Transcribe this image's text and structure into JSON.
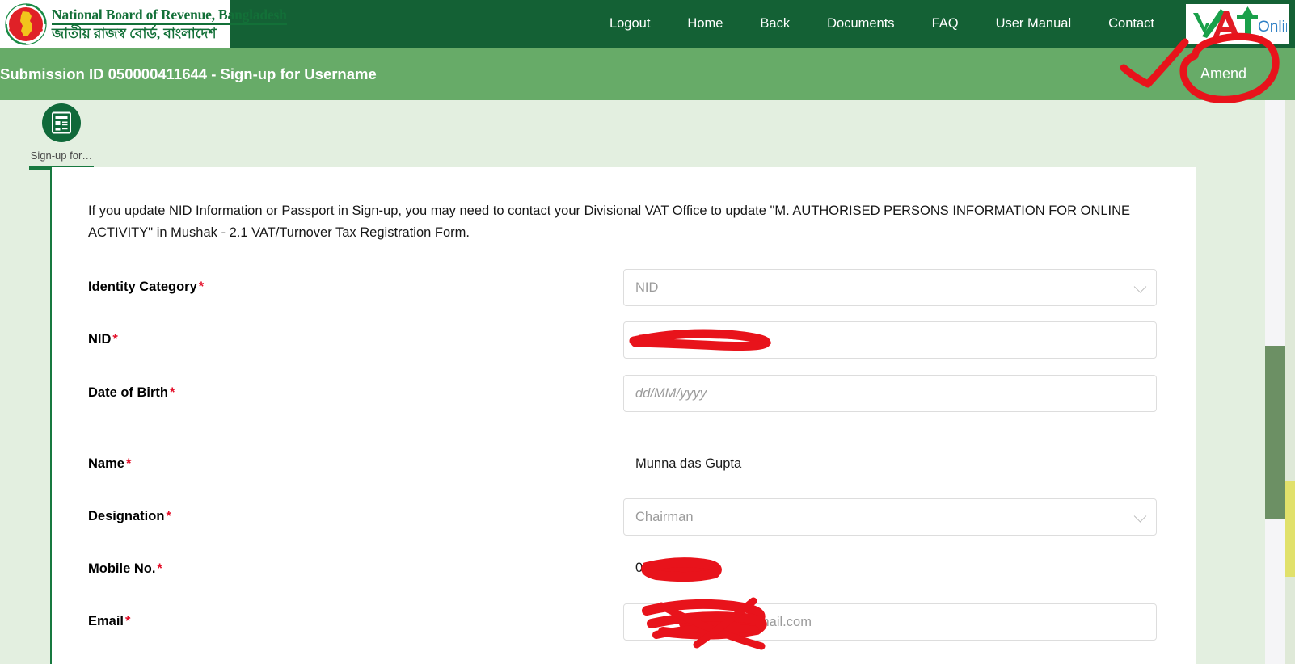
{
  "brand": {
    "english": "National Board of Revenue, Bangladesh",
    "bangla": "জাতীয় রাজস্ব বোর্ড, বাংলাদেশ",
    "emblem_icon": "nbr-emblem-icon"
  },
  "nav": {
    "items": [
      {
        "label": "Logout"
      },
      {
        "label": "Home"
      },
      {
        "label": "Back"
      },
      {
        "label": "Documents"
      },
      {
        "label": "FAQ"
      },
      {
        "label": "User Manual"
      },
      {
        "label": "Contact"
      }
    ],
    "logo": {
      "v": "V",
      "a": "A",
      "t": "T",
      "online": "Online"
    }
  },
  "submission": {
    "title": "Submission ID 050000411644 - Sign-up for Username",
    "amend_label": "Amend"
  },
  "tab": {
    "label": "Sign-up for…",
    "icon": "form-document-icon"
  },
  "notice": "If you update NID Information or Passport in Sign-up, you may need to contact your Divisional VAT Office to update \"M. AUTHORISED PERSONS INFORMATION FOR ONLINE ACTIVITY\" in Mushak - 2.1 VAT/Turnover Tax Registration Form.",
  "form": {
    "fields": [
      {
        "key": "identity_category",
        "label": "Identity Category",
        "required": true,
        "kind": "select",
        "value": "NID",
        "muted": true,
        "redacted": false
      },
      {
        "key": "nid",
        "label": "NID",
        "required": true,
        "kind": "input",
        "value": "",
        "muted": false,
        "redacted": true
      },
      {
        "key": "date_of_birth",
        "label": "Date of Birth",
        "required": true,
        "kind": "input",
        "value": "",
        "placeholder": "dd/MM/yyyy",
        "muted": true,
        "redacted": false
      },
      {
        "key": "name",
        "label": "Name",
        "required": true,
        "kind": "text",
        "value": "Munna das Gupta",
        "muted": false,
        "redacted": false
      },
      {
        "key": "designation",
        "label": "Designation",
        "required": true,
        "kind": "select",
        "value": "Chairman",
        "muted": true,
        "redacted": false
      },
      {
        "key": "mobile_no",
        "label": "Mobile No.",
        "required": true,
        "kind": "text",
        "value": "0",
        "muted": false,
        "redacted": true
      },
      {
        "key": "email",
        "label": "Email",
        "required": true,
        "kind": "input",
        "value": "@gmail.com",
        "muted": true,
        "redacted": true
      }
    ],
    "required_marker": "*"
  },
  "annotations": {
    "check_mark": "red-check-annotation",
    "amend_circle": "red-circle-annotation",
    "redaction_color": "#e8131b"
  },
  "colors": {
    "header_green": "#146135",
    "bar_green": "#67ab68",
    "page_green": "#e3efe0",
    "accent_green": "#17793f",
    "required_red": "#e4102a",
    "scroll_thumb": "#6c9064"
  },
  "scroll": {
    "vertical_thumb_label": "vertical-scrollbar-thumb"
  }
}
